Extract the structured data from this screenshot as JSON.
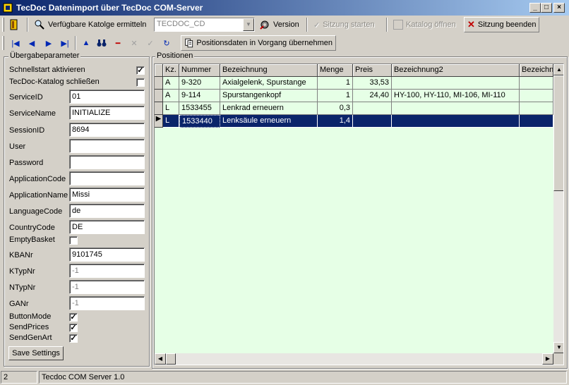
{
  "window": {
    "title": "TecDoc Datenimport über TecDoc COM-Server"
  },
  "toolbar1": {
    "catalogs_label": "Verfügbare Katolge ermitteln",
    "catalog_combo_value": "TECDOC_CD",
    "version_label": "Version",
    "start_session_label": "Sitzung starten",
    "open_catalog_label": "Katalog öffnen",
    "end_session_label": "Sitzung beenden"
  },
  "toolbar2": {
    "apply_positions_label": "Positionsdaten in Vorgang übernehmen"
  },
  "params": {
    "caption": "Übergabeparameter",
    "schnellstart_label": "Schnellstart aktivieren",
    "schnellstart_checked": "✓",
    "catalog_close_label": "TecDoc-Katalog schließen",
    "catalog_close_checked": "",
    "fields": [
      {
        "label": "ServiceID",
        "value": "01"
      },
      {
        "label": "ServiceName",
        "value": "INITIALIZE"
      },
      {
        "label": "SessionID",
        "value": "8694"
      },
      {
        "label": "User",
        "value": ""
      },
      {
        "label": "Password",
        "value": ""
      },
      {
        "label": "ApplicationCode",
        "value": ""
      },
      {
        "label": "ApplicationName",
        "value": "Missi"
      },
      {
        "label": "LanguageCode",
        "value": "de"
      },
      {
        "label": "CountryCode",
        "value": "DE"
      }
    ],
    "empty_basket_label": "EmptyBasket",
    "empty_basket_checked": "",
    "kbanr_label": "KBANr",
    "kbanr_value": "9101745",
    "ktypnr_label": "KTypNr",
    "ktypnr_value": "-1",
    "ntypnr_label": "NTypNr",
    "ntypnr_value": "-1",
    "ganr_label": "GANr",
    "ganr_value": "-1",
    "button_mode_label": "ButtonMode",
    "button_mode_checked": "✓",
    "send_prices_label": "SendPrices",
    "send_prices_checked": "✓",
    "send_gen_art_label": "SendGenArt",
    "send_gen_art_checked": "✓",
    "save_settings_label": "Save Settings"
  },
  "positions": {
    "caption": "Positionen",
    "columns": [
      "Kz.",
      "Nummer",
      "Bezeichnung",
      "Menge",
      "Preis",
      "Bezeichnung2",
      "Bezeichnu"
    ],
    "rows": [
      {
        "kz": "A",
        "nummer": "9-320",
        "bezeichnung": "Axialgelenk, Spurstange",
        "menge": "1",
        "preis": "33,53",
        "bezeichnung2": ""
      },
      {
        "kz": "A",
        "nummer": "9-114",
        "bezeichnung": "Spurstangenkopf",
        "menge": "1",
        "preis": "24,40",
        "bezeichnung2": "HY-100, HY-110, MI-106, MI-110"
      },
      {
        "kz": "L",
        "nummer": "1533455",
        "bezeichnung": "Lenkrad erneuern",
        "menge": "0,3",
        "preis": "",
        "bezeichnung2": ""
      },
      {
        "kz": "L",
        "nummer": "1533440",
        "bezeichnung": "Lenksäule erneuern",
        "menge": "1,4",
        "preis": "",
        "bezeichnung2": ""
      }
    ],
    "selected_row_indicator": "▶"
  },
  "statusbar": {
    "panel1": "2",
    "panel2": "Tecdoc COM Server 1.0"
  },
  "colors": {
    "title_start": "#0a246a",
    "grid_bg": "#e6ffe6",
    "selection": "#0a246a"
  }
}
